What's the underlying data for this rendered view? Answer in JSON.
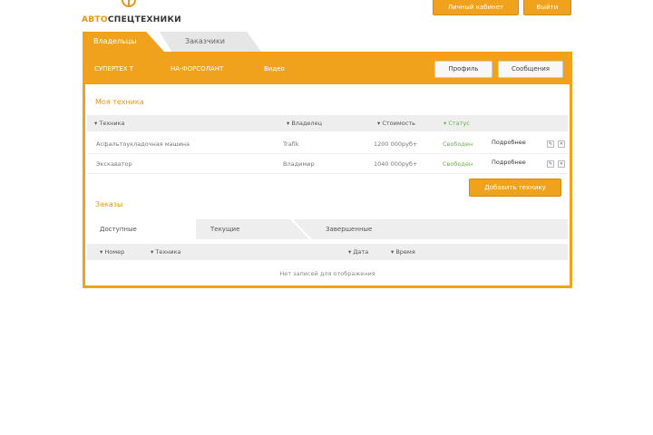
{
  "logo": {
    "text_accent": "АВТО",
    "text_main": "СПЕЦТЕХНИКИ"
  },
  "top_buttons": [
    "Личный кабинет",
    "Выйти"
  ],
  "tabs": {
    "active": "Владельцы",
    "inactive": "Заказчики"
  },
  "nav_links": [
    "СУПЕРТЕХ Т",
    "НА-ФОРСОЛАНТ",
    "Видео"
  ],
  "header_buttons": [
    "Профиль",
    "Сообщения"
  ],
  "equipment": {
    "title": "Моя техника",
    "columns": [
      "Техника",
      "Владелец",
      "Стоимость",
      "Статус"
    ],
    "rows": [
      {
        "name": "Асфальтоукладочная машина",
        "owner": "Trafik",
        "price": "1200 000руб+",
        "status": "Свободен",
        "details": "Подробнее"
      },
      {
        "name": "Экскаватор",
        "owner": "Владимир",
        "price": "1040 000руб+",
        "status": "Свободен",
        "details": "Подробнее"
      }
    ],
    "add_button": "Добавить технику"
  },
  "orders": {
    "title": "Заказы",
    "tabs": [
      "Доступные",
      "Текущие",
      "Завершенные"
    ],
    "columns": [
      "Номер",
      "Техника",
      "Дата",
      "Время"
    ],
    "empty_text": "Нет записей для отображения"
  },
  "colors": {
    "accent": "#f0a21c",
    "status_green": "#5fb93a"
  }
}
